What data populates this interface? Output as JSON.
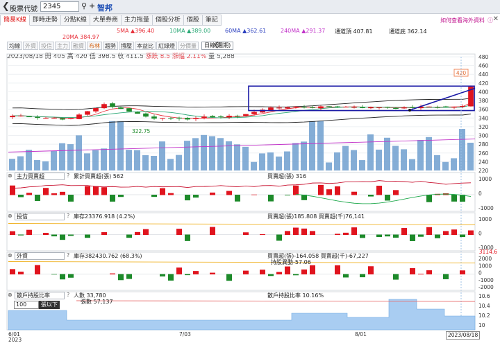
{
  "header": {
    "back_icon": "back-chevron-icon",
    "code_label": "股票代號",
    "code_value": "2345",
    "stock_name": "智邦"
  },
  "tabs": [
    {
      "label": "簡易K線",
      "active": true
    },
    {
      "label": "即時走勢",
      "active": false
    },
    {
      "label": "分點K線",
      "active": false
    },
    {
      "label": "大單券商",
      "active": false
    },
    {
      "label": "主力拖量",
      "active": false
    },
    {
      "label": "個股分析",
      "active": false
    },
    {
      "label": "個股",
      "active": false
    },
    {
      "label": "筆記",
      "active": false
    }
  ],
  "tip": {
    "label": "如何查看海外資料",
    "icon": "question-circle-icon"
  },
  "ma_legend": {
    "ma5": "5MA ▲396.40",
    "ma10": "10MA ▲389.00",
    "ma60": "60MA ▲362.61",
    "ma240": "240MA ▲291.37",
    "ch_upper": "通道頂 407.81",
    "ch_lower": "通道底 362.14",
    "ma20": "20MA 384.97"
  },
  "toolbar": {
    "items": [
      "均線",
      "外資",
      "投信",
      "主力",
      "融資",
      "布林",
      "趨勢",
      "撐壓",
      "本益比",
      "紅綠燈",
      "分價量"
    ],
    "dim": [
      "外資",
      "投信",
      "主力",
      "融資",
      "分價量"
    ],
    "selected": "布林",
    "period": "日線(週期)"
  },
  "quote": {
    "date": "2023/08/18",
    "open_label": "開",
    "open": "405",
    "high_label": "高",
    "high": "420",
    "low_label": "低",
    "low": "398.5",
    "close_label": "收",
    "close": "411.5",
    "chg_label": "漲跌",
    "chg": "8.5",
    "pct_label": "漲幅",
    "pct": "2.11%",
    "vol_label": "量",
    "vol": "5,288"
  },
  "annotations": {
    "high_marker": "420",
    "low_marker": "322.75"
  },
  "price_axis": [
    "480",
    "460",
    "440",
    "420",
    "400",
    "380",
    "360",
    "340",
    "320",
    "300",
    "280",
    "260",
    "240",
    "220"
  ],
  "panels": [
    {
      "select": "主力買賣超",
      "legend1": "累計買賣超(張) 562",
      "legend2": "買賣超(張) 316",
      "axis": [
        "1000",
        "0",
        "-1000"
      ]
    },
    {
      "select": "投信",
      "legend1": "庫存23376.918 (4.2%)",
      "legend2": "買賣超(張)185.808 買賣超(千)76,141",
      "axis": [
        "1000",
        "0",
        "-1000"
      ]
    },
    {
      "select": "外資",
      "legend1": "庫存382430.762 (68.3%)",
      "legend2": "買賣超(張)-164.058 買賣超(千)-67,227",
      "legend3": "持股異動-57.06",
      "axis": [
        "2000",
        "1000",
        "0",
        "-1000",
        "-2000"
      ],
      "hi_label": "3114.6"
    },
    {
      "select": "散戶持股比率",
      "legend1": "人數 33,780",
      "legend2": "張數 57,137",
      "legend3": "散戶持股比率 10.16%",
      "axis": [
        "10.6",
        "10.4",
        "10.2",
        "10"
      ]
    }
  ],
  "filter": {
    "value": "100",
    "button": "張以下"
  },
  "dates": {
    "d1": "6/01",
    "d1y": "2023",
    "d2": "7/03",
    "d3": "8/01",
    "last": "2023/08/18"
  },
  "colors": {
    "up": "#e0141e",
    "down": "#1d8a2a",
    "volume": "#6f9fcf",
    "channel": "#1a1aa6",
    "accent": "#1f4fb5"
  }
}
